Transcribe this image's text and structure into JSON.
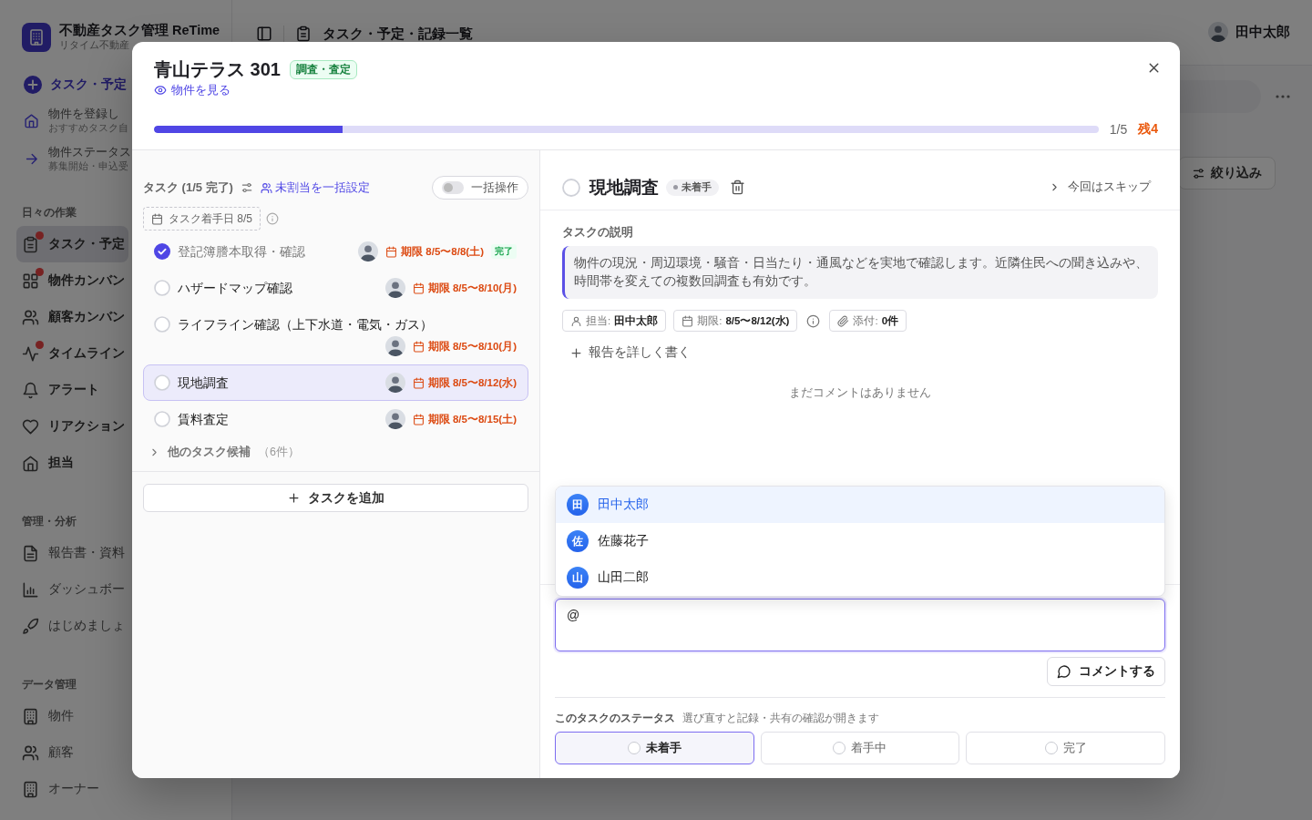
{
  "app": {
    "name": "不動産タスク管理 ReTime",
    "subtitle": "リタイム不動産"
  },
  "sidebar": {
    "quick": [
      {
        "kind": "primary",
        "label": "タスク・予定"
      },
      {
        "kind": "hint",
        "label": "物件を登録し",
        "sub": "おすすめタスク自"
      },
      {
        "kind": "hint",
        "label": "物件ステータス",
        "sub": "募集開始・申込受"
      }
    ],
    "sections": [
      {
        "title": "日々の作業",
        "items": [
          {
            "label": "タスク・予定",
            "selected": true,
            "notification": true
          },
          {
            "label": "物件カンバン",
            "selected": false,
            "notification": true
          },
          {
            "label": "顧客カンバン",
            "selected": false,
            "notification": false
          },
          {
            "label": "タイムライン",
            "selected": false,
            "notification": true
          },
          {
            "label": "アラート",
            "selected": false,
            "notification": false
          },
          {
            "label": "リアクション",
            "selected": false,
            "notification": false
          },
          {
            "label": "担当",
            "selected": false,
            "notification": false
          }
        ]
      },
      {
        "title": "管理・分析",
        "items": [
          {
            "label": "報告書・資料",
            "selected": false,
            "notification": false
          },
          {
            "label": "ダッシュボー",
            "selected": false,
            "notification": false
          },
          {
            "label": "はじめましょ",
            "selected": false,
            "notification": false
          }
        ]
      },
      {
        "title": "データ管理",
        "items": [
          {
            "label": "物件",
            "selected": false,
            "notification": false
          },
          {
            "label": "顧客",
            "selected": false,
            "notification": false
          },
          {
            "label": "オーナー",
            "selected": false,
            "notification": false
          }
        ]
      }
    ]
  },
  "header": {
    "title": "タスク・予定・記録一覧",
    "user": "田中太郎",
    "filter_button": "絞り込み"
  },
  "modal": {
    "title": "青山テラス 301",
    "tag": "調査・査定",
    "link": "物件を見る",
    "progress": {
      "level": 0.2,
      "count": "1/5",
      "remaining": "残4"
    },
    "tasks": {
      "heading": "タスク (1/5 完了)",
      "bulk_assign": "未割当を一括設定",
      "bulk_toggle": {
        "label": "一括操作",
        "on": false
      },
      "start_date": "タスク着手日 8/5",
      "items": [
        {
          "name": "登記簿謄本取得・確認",
          "due": "期限 8/5〜8/8(土)",
          "badge": "完了",
          "checked": true,
          "selected": false
        },
        {
          "name": "ハザードマップ確認",
          "due": "期限 8/5〜8/10(月)",
          "checked": false,
          "selected": false
        },
        {
          "name": "ライフライン確認（上下水道・電気・ガス）",
          "due": "期限 8/5〜8/10(月)",
          "checked": false,
          "selected": false
        },
        {
          "name": "現地調査",
          "due": "期限 8/5〜8/12(水)",
          "checked": false,
          "selected": true
        },
        {
          "name": "賃料査定",
          "due": "期限 8/5〜8/15(土)",
          "checked": false,
          "selected": false
        }
      ],
      "more": {
        "label": "他のタスク候補",
        "count": "（6件）",
        "expanded": false
      },
      "add_button": "タスクを追加"
    },
    "detail": {
      "title": "現地調査",
      "checked": false,
      "status": "未着手",
      "skip": "今回はスキップ",
      "description_label": "タスクの説明",
      "description": "物件の現況・周辺環境・騒音・日当たり・通風などを実地で確認します。近隣住民への聞き込みや、時間帯を変えての複数回調査も有効です。",
      "meta": [
        {
          "label": "担当:",
          "value": "田中太郎"
        },
        {
          "label": "期限:",
          "value": "8/5〜8/12(水)"
        },
        {
          "label": "添付:",
          "value": "0件"
        }
      ],
      "write_report": "報告を詳しく書く",
      "empty_comments": "まだコメントはありません",
      "mentions": [
        {
          "initial": "田",
          "name": "田中太郎",
          "selected": true
        },
        {
          "initial": "佐",
          "name": "佐藤花子",
          "selected": false
        },
        {
          "initial": "山",
          "name": "山田二郎",
          "selected": false
        }
      ],
      "comment": {
        "value": "@"
      },
      "comment_button": "コメントする",
      "status_label": "このタスクのステータス",
      "status_hint": "選び直すと記録・共有の確認が開きます",
      "statuses": [
        {
          "label": "未着手",
          "selected": true
        },
        {
          "label": "着手中",
          "selected": false
        },
        {
          "label": "完了",
          "selected": false
        }
      ]
    }
  }
}
